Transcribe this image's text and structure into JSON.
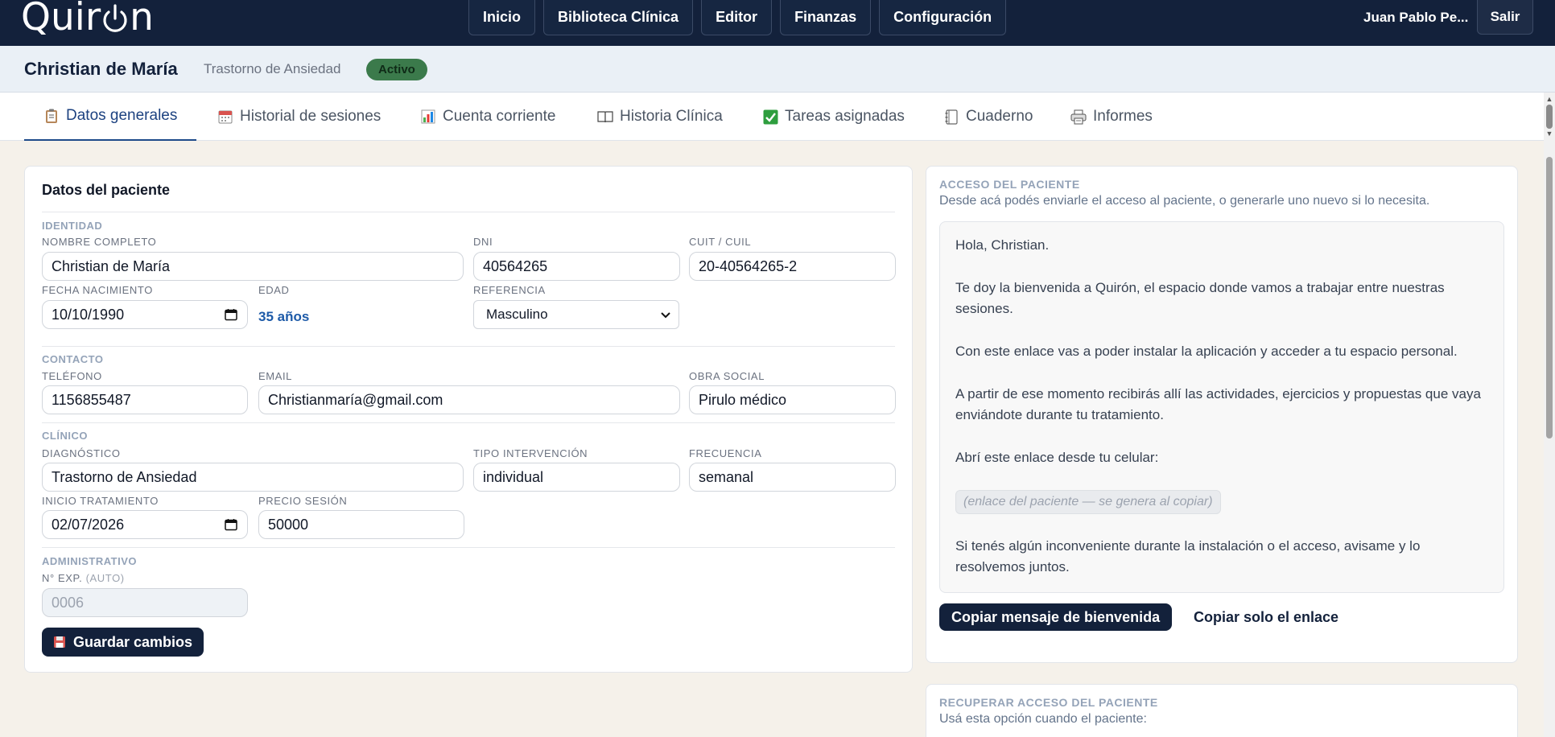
{
  "topbar": {
    "logo_prefix": "Quir",
    "logo_suffix": "n",
    "nav": [
      "Inicio",
      "Biblioteca Clínica",
      "Editor",
      "Finanzas",
      "Configuración"
    ],
    "user_name": "Juan Pablo Pe...",
    "logout": "Salir"
  },
  "patient": {
    "name": "Christian de María",
    "diagnosis": "Trastorno de Ansiedad",
    "status": "Activo"
  },
  "tabs": [
    {
      "label": "Datos generales",
      "icon": "clipboard-icon"
    },
    {
      "label": "Historial de sesiones",
      "icon": "calendar-icon"
    },
    {
      "label": "Cuenta corriente",
      "icon": "bar-chart-icon"
    },
    {
      "label": "Historia Clínica",
      "icon": "book-icon"
    },
    {
      "label": "Tareas asignadas",
      "icon": "check-icon"
    },
    {
      "label": "Cuaderno",
      "icon": "notebook-icon"
    },
    {
      "label": "Informes",
      "icon": "printer-icon"
    }
  ],
  "form": {
    "title": "Datos del paciente",
    "sections": {
      "identity": "IDENTIDAD",
      "contact": "CONTACTO",
      "clinical": "CLÍNICO",
      "admin": "ADMINISTRATIVO"
    },
    "labels": {
      "full_name": "NOMBRE COMPLETO",
      "dni": "DNI",
      "cuit": "CUIT / CUIL",
      "birth": "FECHA NACIMIENTO",
      "age": "EDAD",
      "reference": "REFERENCIA",
      "phone": "TELÉFONO",
      "email": "EMAIL",
      "insurance": "OBRA SOCIAL",
      "diagnosis": "DIAGNÓSTICO",
      "intervention": "TIPO INTERVENCIÓN",
      "frequency": "FRECUENCIA",
      "start": "INICIO TRATAMIENTO",
      "price": "PRECIO SESIÓN",
      "exp": "N° EXP.",
      "exp_auto": "(AUTO)"
    },
    "values": {
      "full_name": "Christian de María",
      "dni": "40564265",
      "cuit": "20-40564265-2",
      "birth": "10/10/1990",
      "age": "35 años",
      "reference": "Masculino",
      "phone": "1156855487",
      "email": "Christianmaría@gmail.com",
      "insurance": "Pirulo médico",
      "diagnosis": "Trastorno de Ansiedad",
      "intervention": "individual",
      "frequency": "semanal",
      "start": "02/07/2026",
      "price": "50000",
      "exp": "0006"
    },
    "save": "Guardar cambios"
  },
  "access": {
    "label": "ACCESO DEL PACIENTE",
    "desc": "Desde acá podés enviarle el acceso al paciente, o generarle uno nuevo si lo necesita.",
    "message": {
      "greeting": "Hola, Christian.",
      "p1": "Te doy la bienvenida a Quirón, el espacio donde vamos a trabajar entre nuestras sesiones.",
      "p2": "Con este enlace vas a poder instalar la aplicación y acceder a tu espacio personal.",
      "p3": "A partir de ese momento recibirás allí las actividades, ejercicios y propuestas que vaya enviándote durante tu tratamiento.",
      "p4": "Abrí este enlace desde tu celular:",
      "link_placeholder": "(enlace del paciente — se genera al copiar)",
      "p5": "Si tenés algún inconveniente durante la instalación o el acceso, avisame y lo resolvemos juntos."
    },
    "copy_message": "Copiar mensaje de bienvenida",
    "copy_link": "Copiar solo el enlace"
  },
  "recover": {
    "label": "RECUPERAR ACCESO DEL PACIENTE",
    "desc": "Usá esta opción cuando el paciente:"
  }
}
